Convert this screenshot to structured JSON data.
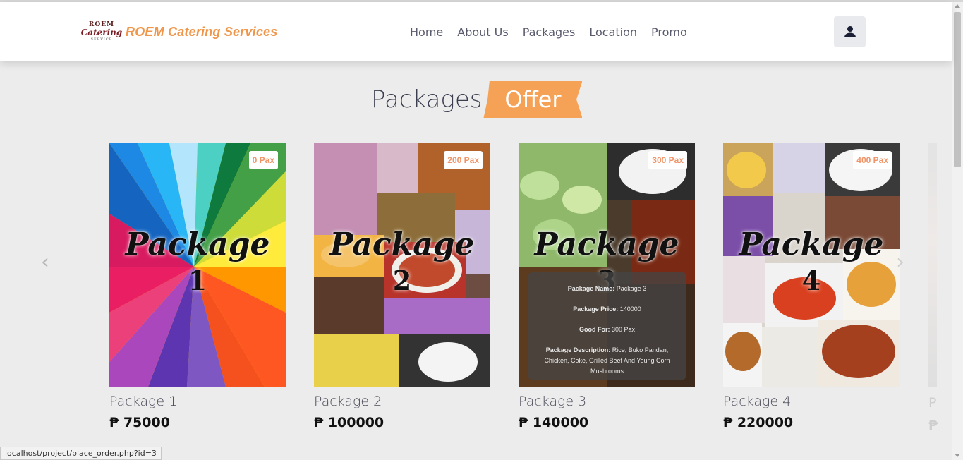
{
  "brand": {
    "logo_line1": "ROEM",
    "logo_line2": "Catering",
    "logo_line3": "SERVICE",
    "name": "ROEM Catering Services"
  },
  "nav": {
    "items": [
      "Home",
      "About Us",
      "Packages",
      "Location",
      "Promo"
    ]
  },
  "user_icon": "user-icon",
  "heading": {
    "plain": "Packages",
    "highlight": "Offer"
  },
  "colors": {
    "accent": "#f5a257",
    "brand": "#f0964a",
    "badge_text": "#f09468"
  },
  "cards": [
    {
      "word": "Package",
      "num": "1",
      "pax": "0 Pax",
      "title": "Package 1",
      "price": "₱ 75000"
    },
    {
      "word": "Package",
      "num": "2",
      "pax": "200 Pax",
      "title": "Package 2",
      "price": "₱ 100000"
    },
    {
      "word": "Package",
      "num": "3",
      "pax": "300 Pax",
      "title": "Package 3",
      "price": "₱ 140000",
      "overlay": {
        "name_label": "Package Name:",
        "name_value": "Package 3",
        "price_label": "Package Price:",
        "price_value": "140000",
        "good_label": "Good For:",
        "good_value": "300 Pax",
        "desc_label": "Package Description:",
        "desc_value": "Rice, Buko Pandan, Chicken, Coke, Grilled Beef And Young Corn Mushrooms"
      }
    },
    {
      "word": "Package",
      "num": "4",
      "pax": "400 Pax",
      "title": "Package 4",
      "price": "₱ 220000"
    },
    {
      "title": "P",
      "price": "₱"
    }
  ],
  "carousel": {
    "prev": "‹",
    "next": "›"
  },
  "status_bar": "localhost/project/place_order.php?id=3"
}
